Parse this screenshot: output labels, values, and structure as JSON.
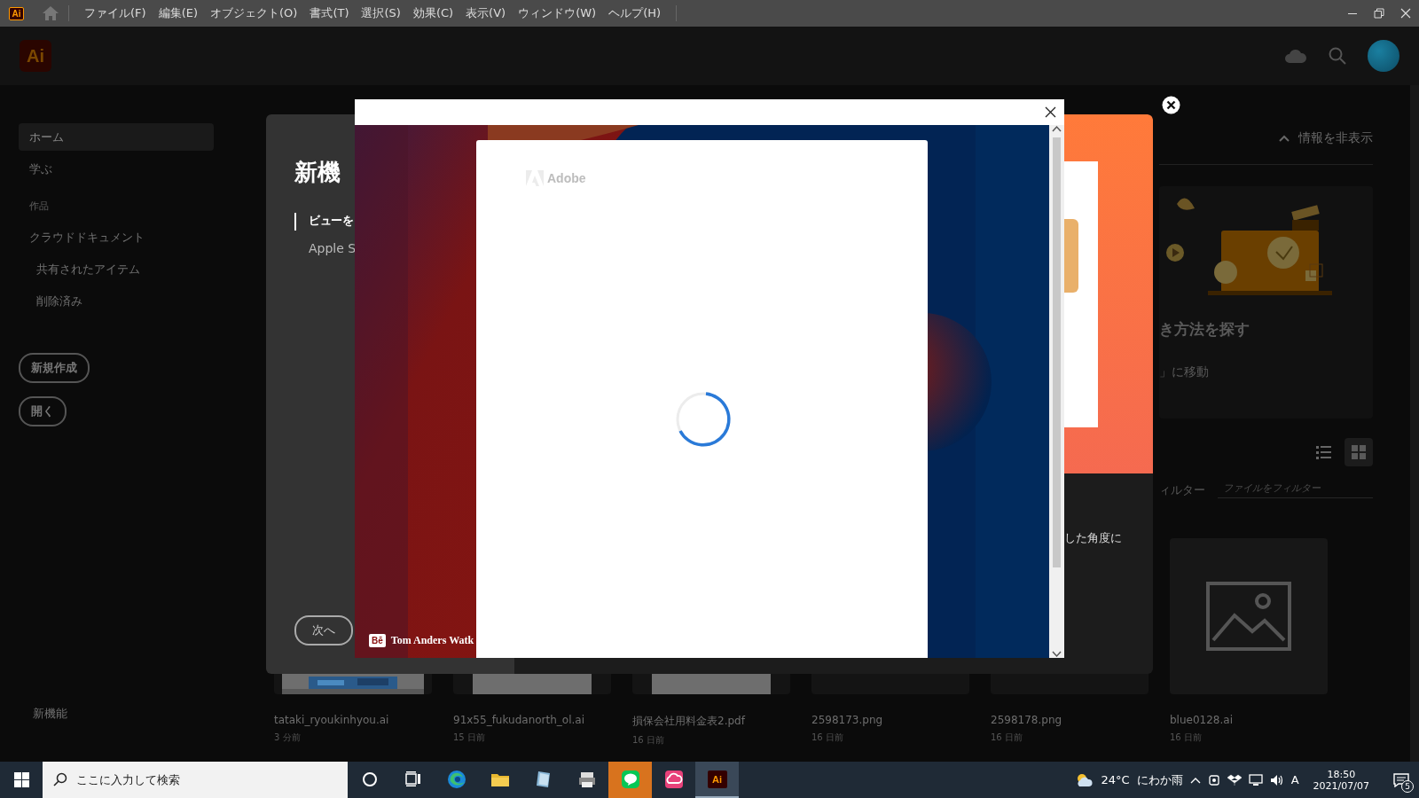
{
  "title_bar": {
    "app_badge": "Ai",
    "menu": [
      "ファイル(F)",
      "編集(E)",
      "オブジェクト(O)",
      "書式(T)",
      "選択(S)",
      "効果(C)",
      "表示(V)",
      "ウィンドウ(W)",
      "ヘルプ(H)"
    ]
  },
  "header": {
    "logo": "Ai"
  },
  "sidebar": {
    "nav": [
      {
        "label": "ホーム",
        "selected": true
      },
      {
        "label": "学ぶ",
        "selected": false
      }
    ],
    "section_heading": "作品",
    "documents": [
      {
        "label": "クラウドドキュメント",
        "selected": false,
        "children": [
          {
            "label": "共有されたアイテム",
            "selected": false
          },
          {
            "label": "削除済み",
            "selected": false
          }
        ]
      }
    ],
    "buttons": [
      "新規作成",
      "開く"
    ],
    "footer": "新機能"
  },
  "home_panel": {
    "hide_info": "情報を非表示",
    "learn_title": "き方法を探す",
    "learn_link": "」に移動",
    "view_modes": [
      {
        "kind": "list",
        "selected": false
      },
      {
        "kind": "grid",
        "selected": true
      }
    ],
    "filter_label": "ィルター",
    "filter": {
      "placeholder": "ファイルをフィルター"
    }
  },
  "files": [
    {
      "name": "tataki_ryoukinhyou.ai",
      "time": "3 分前",
      "kind": "picture"
    },
    {
      "name": "91x55_fukudanorth_ol.ai",
      "time": "15 日前",
      "kind": "document"
    },
    {
      "name": "損保会社用料金表2.pdf",
      "time": "16 日前",
      "kind": "document"
    },
    {
      "name": "2598173.png",
      "time": "16 日前",
      "kind": "empty"
    },
    {
      "name": "2598178.png",
      "time": "16 日前",
      "kind": "empty"
    },
    {
      "name": "blue0128.ai",
      "time": "16 日前",
      "kind": "placeholder"
    }
  ],
  "whats_new_dialog": {
    "title": "新機",
    "items": [
      {
        "title": "ビューを",
        "text": "Apple S",
        "selected": true
      }
    ],
    "media_caption": "した角度に",
    "next_button": "次へ"
  },
  "web_popup": {
    "brand": "Adobe",
    "loading": true,
    "credit_badge": "Bē",
    "credit": "Tom Anders Watk"
  },
  "taskbar": {
    "search": {
      "placeholder": "ここに入力して検索"
    },
    "apps": [
      {
        "kind": "cortana",
        "flashing": false,
        "active": false
      },
      {
        "kind": "taskview",
        "flashing": false,
        "active": false
      },
      {
        "kind": "edge",
        "flashing": false,
        "active": false
      },
      {
        "kind": "explorer",
        "flashing": false,
        "active": false
      },
      {
        "kind": "notebook",
        "flashing": false,
        "active": false
      },
      {
        "kind": "printer",
        "flashing": false,
        "active": false
      },
      {
        "kind": "line",
        "flashing": true,
        "active": false
      },
      {
        "kind": "creative-cloud",
        "flashing": false,
        "active": false
      },
      {
        "kind": "illustrator",
        "flashing": false,
        "active": true,
        "label": "Ai"
      }
    ],
    "temperature": "24°C",
    "weather": "にわか雨",
    "ime": "A",
    "time": "18:50",
    "date": "2021/07/07",
    "notifications": "5"
  }
}
